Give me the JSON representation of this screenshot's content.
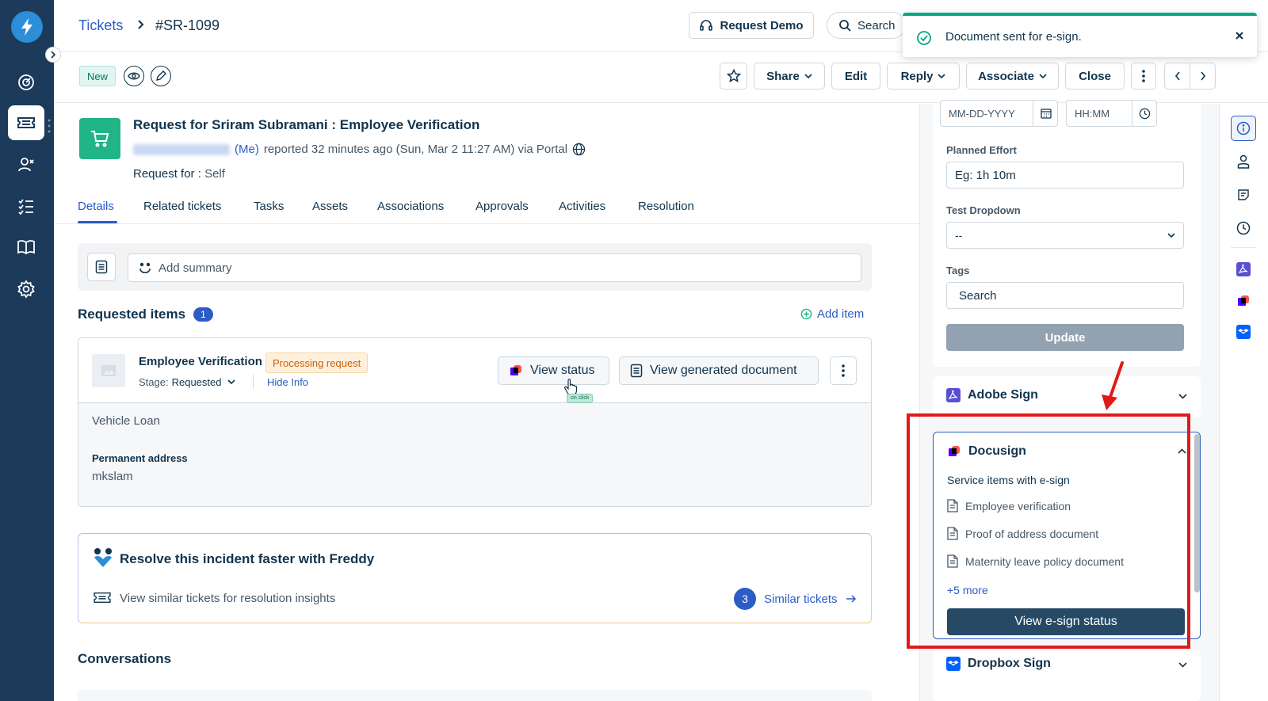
{
  "breadcrumb": {
    "parent": "Tickets",
    "current": "#SR-1099"
  },
  "header": {
    "request_demo": "Request Demo",
    "search": "Search"
  },
  "toast": {
    "message": "Document sent for e-sign."
  },
  "toolbar": {
    "status_badge": "New",
    "share": "Share",
    "edit": "Edit",
    "reply": "Reply",
    "associate": "Associate",
    "close": "Close"
  },
  "ticket": {
    "title": "Request for Sriram Subramani : Employee Verification",
    "me_label": "(Me)",
    "meta": "reported 32 minutes ago (Sun, Mar 2 11:27 AM) via Portal",
    "request_for_label": "Request for :",
    "request_for_value": "Self"
  },
  "tabs": [
    "Details",
    "Related tickets",
    "Tasks",
    "Assets",
    "Associations",
    "Approvals",
    "Activities",
    "Resolution"
  ],
  "summary": {
    "placeholder": "Add summary"
  },
  "requested_items": {
    "title": "Requested items",
    "count": "1",
    "add_item": "Add item",
    "item": {
      "name": "Employee Verification",
      "badge": "Processing request",
      "stage_label": "Stage:",
      "stage_value": "Requested",
      "hide_info": "Hide Info",
      "view_status": "View status",
      "view_document": "View generated document",
      "on_click_tag": "on click",
      "field1_value": "Vehicle Loan",
      "field2_label": "Permanent address",
      "field2_value": "mkslam"
    }
  },
  "freddy": {
    "title": "Resolve this incident faster with Freddy",
    "subtitle": "View similar tickets for resolution insights",
    "similar_count": "3",
    "similar_label": "Similar tickets"
  },
  "conversations": {
    "title": "Conversations"
  },
  "properties": {
    "date_placeholder": "MM-DD-YYYY",
    "time_placeholder": "HH:MM",
    "planned_effort_label": "Planned Effort",
    "planned_effort_placeholder": "Eg: 1h 10m",
    "test_dropdown_label": "Test Dropdown",
    "test_dropdown_value": "--",
    "tags_label": "Tags",
    "tags_placeholder": "Search",
    "update": "Update"
  },
  "apps": {
    "adobe_sign": "Adobe Sign",
    "docusign": {
      "title": "Docusign",
      "subtitle": "Service items with e-sign",
      "items": [
        "Employee verification",
        "Proof of address document",
        "Maternity leave policy document"
      ],
      "more": "+5 more",
      "button": "View e-sign status"
    },
    "dropbox_sign": "Dropbox Sign"
  },
  "colors": {
    "primary": "#2c5cc5",
    "nav_bg": "#1c3a5a",
    "success": "#00a886",
    "highlight_red": "#e01a1a",
    "esign_button": "#264966"
  }
}
